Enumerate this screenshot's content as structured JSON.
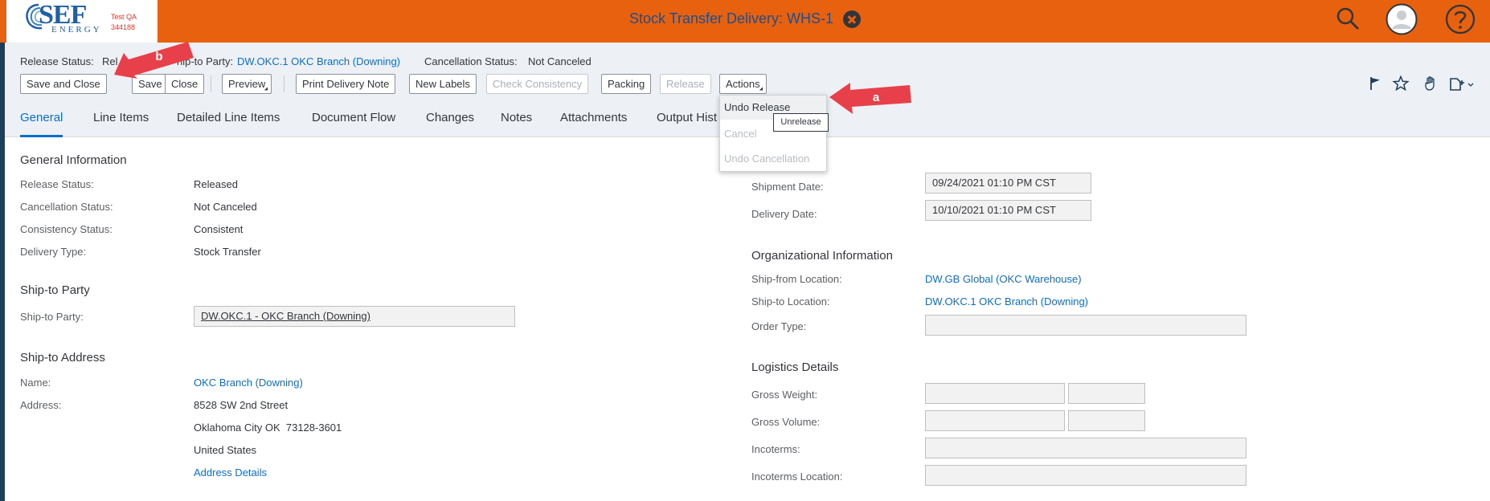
{
  "shell": {
    "logo_text": "SEF",
    "logo_sub": "ENERGY",
    "env_line1": "Test QA",
    "env_line2": "344188",
    "title": "Stock Transfer Delivery: WHS-1"
  },
  "header": {
    "release_status_label": "Release Status:",
    "release_status_value": "Rel",
    "ship_to_party_label": "hip-to Party:",
    "ship_to_party_value": "DW.OKC.1 OKC Branch (Downing)",
    "cancellation_status_label": "Cancellation Status:",
    "cancellation_status_value": "Not Canceled"
  },
  "toolbar": {
    "save_and_close": "Save and Close",
    "save": "Save",
    "close": "Close",
    "preview": "Preview",
    "print_delivery_note": "Print Delivery Note",
    "new_labels": "New Labels",
    "check_consistency": "Check Consistency",
    "packing": "Packing",
    "release": "Release",
    "actions": "Actions"
  },
  "tabs": [
    {
      "label": "General",
      "selected": true
    },
    {
      "label": "Line Items"
    },
    {
      "label": "Detailed Line Items"
    },
    {
      "label": "Document Flow"
    },
    {
      "label": "Changes"
    },
    {
      "label": "Notes"
    },
    {
      "label": "Attachments"
    },
    {
      "label": "Output Hist"
    }
  ],
  "actions_menu": {
    "items": [
      {
        "label": "Undo Release",
        "enabled": true
      },
      {
        "label": "Cancel",
        "enabled": false
      },
      {
        "label": "Undo Cancellation",
        "enabled": false
      }
    ],
    "tooltip": "Unrelease"
  },
  "callouts": {
    "a": "a",
    "b": "b"
  },
  "general_information": {
    "title": "General Information",
    "release_status_label": "Release Status:",
    "release_status": "Released",
    "cancellation_status_label": "Cancellation Status:",
    "cancellation_status": "Not Canceled",
    "consistency_status_label": "Consistency Status:",
    "consistency_status": "Consistent",
    "delivery_type_label": "Delivery Type:",
    "delivery_type": "Stock Transfer"
  },
  "ship_to_party": {
    "title": "Ship-to Party",
    "label": "Ship-to Party:",
    "value": "DW.OKC.1 - OKC Branch (Downing)"
  },
  "ship_to_address": {
    "title": "Ship-to Address",
    "name_label": "Name:",
    "name": "OKC Branch (Downing)",
    "address_label": "Address:",
    "line1": "8528 SW 2nd Street",
    "line2": "Oklahoma City OK  73128-3601",
    "line3": "United States",
    "details_link": "Address Details"
  },
  "dates": {
    "shipment_date_label": "Shipment Date:",
    "shipment_date": "09/24/2021 01:10 PM CST",
    "delivery_date_label": "Delivery Date:",
    "delivery_date": "10/10/2021 01:10 PM CST"
  },
  "organizational_information": {
    "title": "Organizational Information",
    "ship_from_label": "Ship-from Location:",
    "ship_from": "DW.GB Global (OKC Warehouse)",
    "ship_to_label": "Ship-to Location:",
    "ship_to": "DW.OKC.1 OKC Branch (Downing)",
    "order_type_label": "Order Type:",
    "order_type": ""
  },
  "logistics_details": {
    "title": "Logistics Details",
    "gross_weight_label": "Gross Weight:",
    "gross_volume_label": "Gross Volume:",
    "incoterms_label": "Incoterms:",
    "incoterms_location_label": "Incoterms Location:"
  },
  "colors": {
    "shell": "#e8610f",
    "link": "#0a6ed1",
    "callout": "#e8404a"
  }
}
